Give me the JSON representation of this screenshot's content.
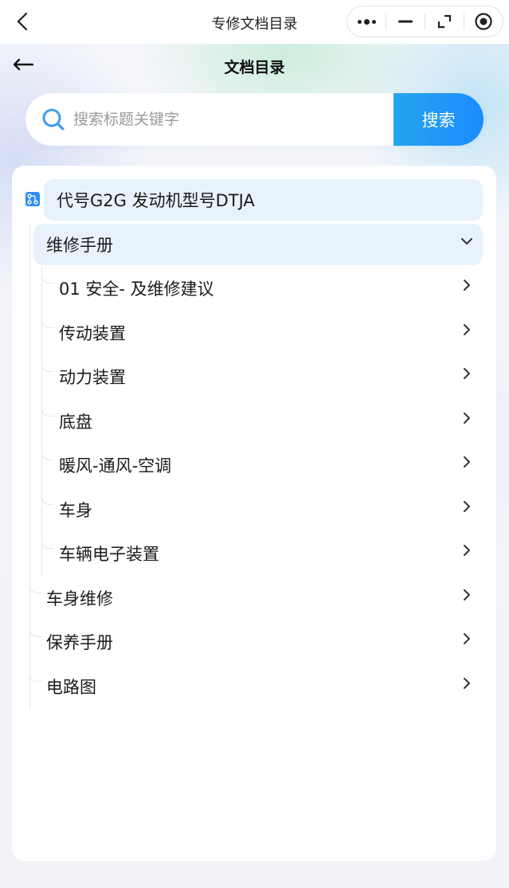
{
  "topbar": {
    "title": "专修文档目录",
    "back_icon": "chevron-left-icon",
    "capsule": [
      "more-icon",
      "minimize-icon",
      "restore-icon",
      "record-icon"
    ]
  },
  "header": {
    "title": "文档目录",
    "back_icon": "arrow-left-icon"
  },
  "search": {
    "placeholder": "搜索标题关键字",
    "value": "",
    "button_label": "搜索",
    "button_color": "#1a8cff"
  },
  "tree": {
    "root": {
      "label": "代号G2G 发动机型号DTJA",
      "icon": "tree-structure-icon"
    },
    "sections": [
      {
        "label": "维修手册",
        "expanded": true,
        "children": [
          {
            "label": "01 安全- 及维修建议"
          },
          {
            "label": "传动装置"
          },
          {
            "label": "动力装置"
          },
          {
            "label": "底盘"
          },
          {
            "label": "暖风-通风-空调"
          },
          {
            "label": "车身"
          },
          {
            "label": "车辆电子装置"
          }
        ]
      },
      {
        "label": "车身维修",
        "expanded": false
      },
      {
        "label": "保养手册",
        "expanded": false
      },
      {
        "label": "电路图",
        "expanded": false
      }
    ]
  },
  "colors": {
    "accent": "#1a8cff",
    "highlight_bg": "#e8f2fc"
  }
}
